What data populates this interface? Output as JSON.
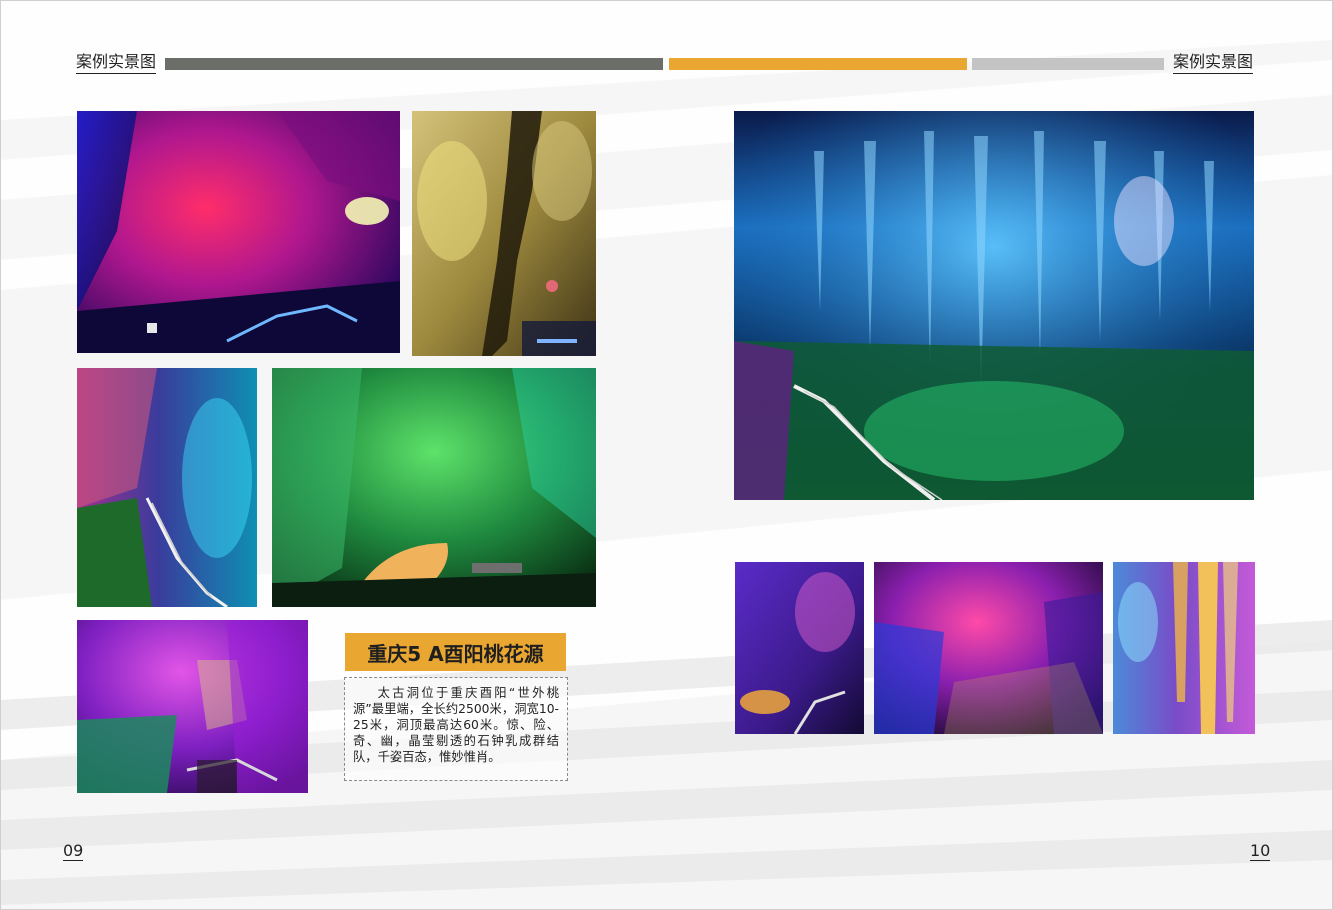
{
  "header": {
    "left_label": "案例实景图",
    "right_label": "案例实景图",
    "bar_colors": [
      "#6b6d69",
      "#e9a732",
      "#c4c4c4"
    ]
  },
  "caption": {
    "title": "重庆5 A酉阳桃花源",
    "description": "太古洞位于重庆酉阳“世外桃源”最里端，全长约2500米，洞宽10-25米，洞顶最高达60米。惊、险、奇、幽，晶莹剔透的石钟乳成群结队，千姿百态，惟妙惟肖。"
  },
  "pages": {
    "left_number": "09",
    "right_number": "10"
  },
  "colors": {
    "accent": "#e9a732",
    "dark_bar": "#6b6d69",
    "light_bar": "#c4c4c4"
  }
}
